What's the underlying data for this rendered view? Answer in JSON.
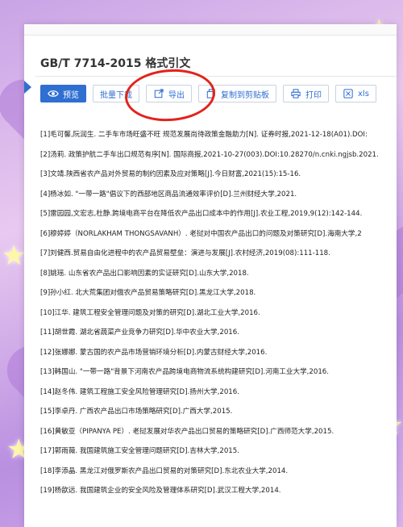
{
  "panel": {
    "title": "GB/T 7714-2015 格式引文"
  },
  "toolbar": [
    {
      "label": "预览",
      "icon": "eye-icon"
    },
    {
      "label": "批量下载",
      "icon": ""
    },
    {
      "label": "导出",
      "icon": "export-icon"
    },
    {
      "label": "复制到剪贴板",
      "icon": "copy-icon"
    },
    {
      "label": "打印",
      "icon": "printer-icon"
    },
    {
      "label": "xls",
      "icon": "excel-icon"
    }
  ],
  "references": [
    "[1]毛可馨,阮润生. 二手车市场旺盛不旺 规范发展尚待政策金融助力[N]. 证券时报,2021-12-18(A01).DOI:",
    "[2]汤莉. 政策护航二手车出口规范有序[N]. 国际商报,2021-10-27(003).DOI:10.28270/n.cnki.ngjsb.2021.",
    "[3]文靖.陕西省农产品对外贸易的制约因素及应对策略[J].今日财富,2021(15):15-16.",
    "[4]杨冰如. \"一带一路\"倡议下的西部地区商品流通效率评价[D].兰州财经大学,2021.",
    "[5]雷园园,文宏志,杜静.跨境电商平台在降低农产品出口成本中的作用[J].农业工程,2019,9(12):142-144.",
    "[6]穆婷婷（NORLAKHAM THONGSAVANH）. 老挝对中国农产品出口的问题及对策研究[D].海南大学,2",
    "[7]刘健西.贸易自由化进程中的农产品贸易壁垒：演进与发展[J].农村经济,2019(08):111-118.",
    "[8]姚瑶. 山东省农产品出口影响因素的实证研究[D].山东大学,2018.",
    "[9]孙小红. 北大荒集团对俄农产品贸易策略研究[D].黑龙江大学,2018.",
    "[10]江华. 建筑工程安全管理问题及对策的研究[D].湖北工业大学,2016.",
    "[11]胡世霞. 湖北省蔬菜产业竞争力研究[D].华中农业大学,2016.",
    "[12]张娜娜. 蒙古国的农产品市场营销环境分析[D].内蒙古财经大学,2016.",
    "[13]韩国山. \"一带一路\"背景下河南农产品跨境电商物流系统构建研究[D].河南工业大学,2016.",
    "[14]赵冬伟. 建筑工程施工安全风险管理研究[D].扬州大学,2016.",
    "[15]李卓丹. 广西农产品出口市场策略研究[D].广西大学,2015.",
    "[16]黄敏亚（PIPANYA PE）. 老挝发展对华农产品出口贸易的策略研究[D].广西师范大学,2015.",
    "[17]郭雨薇. 我国建筑施工安全管理问题研究[D].吉林大学,2015.",
    "[18]李添晶. 黑龙江对俄罗斯农产品出口贸易的对策研究[D].东北农业大学,2014.",
    "[19]杨歆远. 我国建筑企业的安全风险及管理体系研究[D].武汉工程大学,2014."
  ],
  "colors": {
    "accent": "#2f6fd1",
    "annotation_circle": "#e2231a",
    "background": "#c9a4e6"
  }
}
